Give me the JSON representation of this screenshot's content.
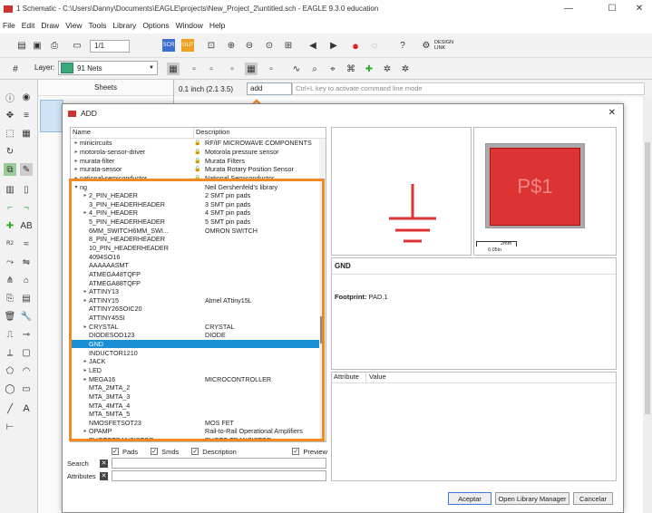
{
  "window": {
    "title": "1 Schematic - C:\\Users\\Danny\\Documents\\EAGLE\\projects\\New_Project_2\\untitled.sch - EAGLE 9.3.0 education",
    "minimize": "—",
    "maximize": "☐",
    "close": "✕"
  },
  "menu": [
    "File",
    "Edit",
    "Draw",
    "View",
    "Tools",
    "Library",
    "Options",
    "Window",
    "Help"
  ],
  "toolbar": {
    "sheet_value": "1/1",
    "design_link": "DESIGN\nLINK",
    "layer_label": "Layer:",
    "layer_value": "91 Nets"
  },
  "sheets_panel": {
    "title": "Sheets"
  },
  "command_bar": {
    "grid": "0.1 inch (2.1 3.5)",
    "input_value": "add",
    "hint": "Ctrl+L key to activate command line mode"
  },
  "dialog": {
    "title": "ADD",
    "columns": {
      "name": "Name",
      "description": "Description"
    },
    "rows": [
      {
        "name": "minicircuits",
        "caret": "▸",
        "lock": true,
        "desc": "RF/IF MICROWAVE COMPONENTS",
        "indent": 0
      },
      {
        "name": "motorola-sensor-driver",
        "caret": "▸",
        "lock": true,
        "desc": "Motorola pressure sensor",
        "indent": 0
      },
      {
        "name": "murata-filter",
        "caret": "▸",
        "lock": true,
        "desc": "Murata Filters",
        "indent": 0
      },
      {
        "name": "murata-sensor",
        "caret": "▸",
        "lock": true,
        "desc": "Murata Rotary Position Sensor",
        "indent": 0
      },
      {
        "name": "national-semiconductor",
        "caret": "▸",
        "lock": true,
        "desc": "National Semiconductor",
        "indent": 0
      },
      {
        "name": "ng",
        "caret": "▾",
        "lock": false,
        "desc": "Neil Gershenfeld's library",
        "indent": 0
      },
      {
        "name": "2_PIN_HEADER",
        "caret": "▸",
        "lock": false,
        "desc": "2 SMT pin pads",
        "indent": 1
      },
      {
        "name": "3_PIN_HEADERHEADER",
        "caret": "",
        "lock": false,
        "desc": "3 SMT pin pads",
        "indent": 1
      },
      {
        "name": "4_PIN_HEADER",
        "caret": "▸",
        "lock": false,
        "desc": "4 SMT pin pads",
        "indent": 1
      },
      {
        "name": "5_PIN_HEADERHEADER",
        "caret": "",
        "lock": false,
        "desc": "5 SMT pin pads",
        "indent": 1
      },
      {
        "name": "6MM_SWITCH6MM_SWI...",
        "caret": "",
        "lock": false,
        "desc": "OMRON SWITCH",
        "indent": 1
      },
      {
        "name": "8_PIN_HEADERHEADER",
        "caret": "",
        "lock": false,
        "desc": "",
        "indent": 1
      },
      {
        "name": "10_PIN_HEADERHEADER",
        "caret": "",
        "lock": false,
        "desc": "",
        "indent": 1
      },
      {
        "name": "4094SO16",
        "caret": "",
        "lock": false,
        "desc": "",
        "indent": 1
      },
      {
        "name": "AAAAAASMT",
        "caret": "",
        "lock": false,
        "desc": "",
        "indent": 1
      },
      {
        "name": "ATMEGA48TQFP",
        "caret": "",
        "lock": false,
        "desc": "",
        "indent": 1
      },
      {
        "name": "ATMEGA88TQFP",
        "caret": "",
        "lock": false,
        "desc": "",
        "indent": 1
      },
      {
        "name": "ATTINY13",
        "caret": "▸",
        "lock": false,
        "desc": "",
        "indent": 1
      },
      {
        "name": "ATTINY15",
        "caret": "▸",
        "lock": false,
        "desc": "Atmel ATtiny15L",
        "indent": 1
      },
      {
        "name": "ATTINY26SOIC20",
        "caret": "",
        "lock": false,
        "desc": "",
        "indent": 1
      },
      {
        "name": "ATTINY45SI",
        "caret": "",
        "lock": false,
        "desc": "",
        "indent": 1
      },
      {
        "name": "CRYSTAL",
        "caret": "▸",
        "lock": false,
        "desc": "CRYSTAL",
        "indent": 1
      },
      {
        "name": "DIODESOD123",
        "caret": "",
        "lock": false,
        "desc": "DIODE",
        "indent": 1
      },
      {
        "name": "GND",
        "caret": "",
        "lock": false,
        "desc": "",
        "indent": 1,
        "selected": true
      },
      {
        "name": "INDUCTOR1210",
        "caret": "",
        "lock": false,
        "desc": "",
        "indent": 1
      },
      {
        "name": "JACK",
        "caret": "▸",
        "lock": false,
        "desc": "",
        "indent": 1
      },
      {
        "name": "LED",
        "caret": "▸",
        "lock": false,
        "desc": "",
        "indent": 1
      },
      {
        "name": "MEGA16",
        "caret": "▸",
        "lock": false,
        "desc": "MICROCONTROLLER",
        "indent": 1
      },
      {
        "name": "MTA_2MTA_2",
        "caret": "",
        "lock": false,
        "desc": "",
        "indent": 1
      },
      {
        "name": "MTA_3MTA_3",
        "caret": "",
        "lock": false,
        "desc": "",
        "indent": 1
      },
      {
        "name": "MTA_4MTA_4",
        "caret": "",
        "lock": false,
        "desc": "",
        "indent": 1
      },
      {
        "name": "MTA_5MTA_5",
        "caret": "",
        "lock": false,
        "desc": "",
        "indent": 1
      },
      {
        "name": "NMOSFETSOT23",
        "caret": "",
        "lock": false,
        "desc": "MOS FET",
        "indent": 1
      },
      {
        "name": "OPAMP",
        "caret": "▸",
        "lock": false,
        "desc": "Rail-to-Rail Operational Amplifiers",
        "indent": 1
      },
      {
        "name": "PHOTOTRANSISTOR...",
        "caret": "▸",
        "lock": false,
        "desc": "PHOTO TRANSISTOR",
        "indent": 1
      }
    ],
    "options": {
      "pads": "Pads",
      "smds": "Smds",
      "description": "Description",
      "preview": "Preview"
    },
    "search_label": "Search",
    "attributes_label": "Attributes",
    "preview_name": "GND",
    "footprint_label": "Footprint:",
    "footprint_value": "PAD.1",
    "pad_label": "P$1",
    "scale_label_1": "2mm",
    "scale_label_2": "0.05in",
    "attr_columns": {
      "attribute": "Attribute",
      "value": "Value"
    },
    "buttons": {
      "accept": "Aceptar",
      "open_library_manager": "Open Library Manager",
      "cancel": "Cancelar"
    }
  },
  "colors": {
    "highlight": "#f08a24",
    "selection": "#1a8fd6",
    "gnd_symbol": "#d33",
    "pad": "#d33"
  }
}
